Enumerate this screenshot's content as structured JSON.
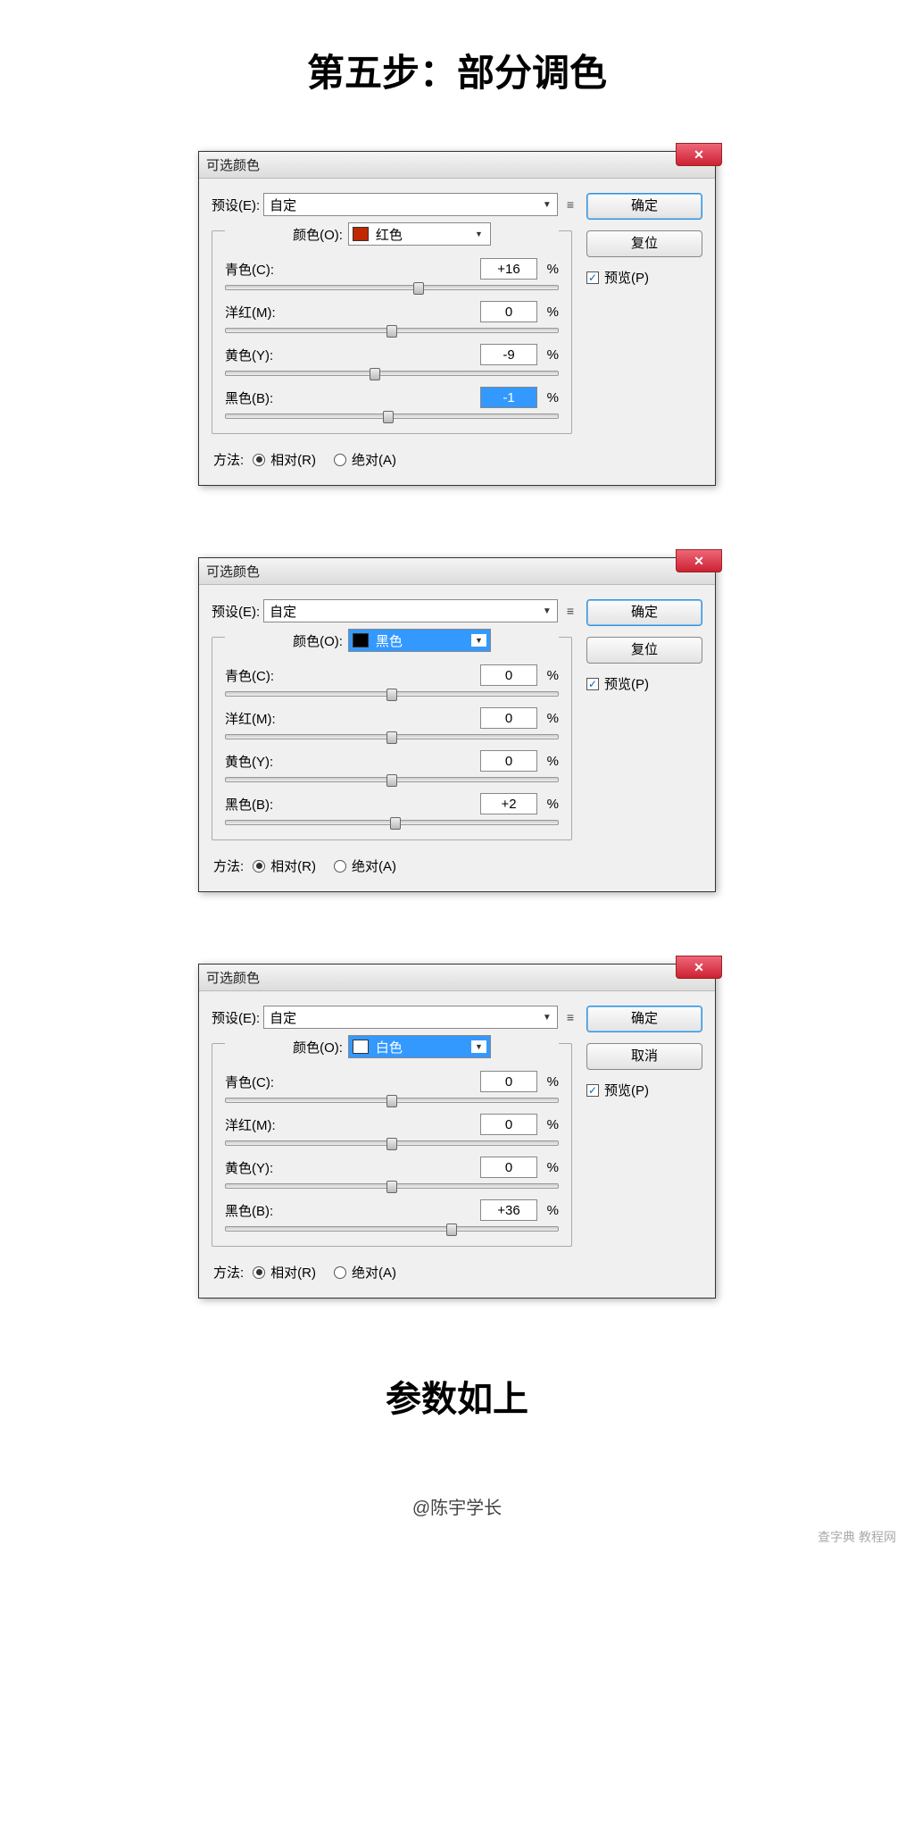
{
  "page_title": "第五步：部分调色",
  "footer_text": "参数如上",
  "credit": "@陈宇学长",
  "watermark": "查字典 教程网",
  "dialogs": [
    {
      "title": "可选颜色",
      "preset_label": "预设(E):",
      "preset_value": "自定",
      "color_label": "颜色(O):",
      "color_swatch": "#c02800",
      "color_name": "红色",
      "color_highlight": false,
      "sliders": [
        {
          "label": "青色(C):",
          "value": "+16",
          "pos": 58,
          "hl": false
        },
        {
          "label": "洋红(M):",
          "value": "0",
          "pos": 50,
          "hl": false
        },
        {
          "label": "黄色(Y):",
          "value": "-9",
          "pos": 45,
          "hl": false
        },
        {
          "label": "黑色(B):",
          "value": "-1",
          "pos": 49,
          "hl": true
        }
      ],
      "method_label": "方法:",
      "method_rel": "相对(R)",
      "method_abs": "绝对(A)",
      "btn_ok": "确定",
      "btn_reset": "复位",
      "preview": "预览(P)"
    },
    {
      "title": "可选颜色",
      "preset_label": "预设(E):",
      "preset_value": "自定",
      "color_label": "颜色(O):",
      "color_swatch": "#000000",
      "color_name": "黑色",
      "color_highlight": true,
      "sliders": [
        {
          "label": "青色(C):",
          "value": "0",
          "pos": 50,
          "hl": false
        },
        {
          "label": "洋红(M):",
          "value": "0",
          "pos": 50,
          "hl": false
        },
        {
          "label": "黄色(Y):",
          "value": "0",
          "pos": 50,
          "hl": false
        },
        {
          "label": "黑色(B):",
          "value": "+2",
          "pos": 51,
          "hl": false
        }
      ],
      "method_label": "方法:",
      "method_rel": "相对(R)",
      "method_abs": "绝对(A)",
      "btn_ok": "确定",
      "btn_reset": "复位",
      "preview": "预览(P)"
    },
    {
      "title": "可选颜色",
      "preset_label": "预设(E):",
      "preset_value": "自定",
      "color_label": "颜色(O):",
      "color_swatch": "#ffffff",
      "color_name": "白色",
      "color_highlight": true,
      "sliders": [
        {
          "label": "青色(C):",
          "value": "0",
          "pos": 50,
          "hl": false
        },
        {
          "label": "洋红(M):",
          "value": "0",
          "pos": 50,
          "hl": false
        },
        {
          "label": "黄色(Y):",
          "value": "0",
          "pos": 50,
          "hl": false
        },
        {
          "label": "黑色(B):",
          "value": "+36",
          "pos": 68,
          "hl": false
        }
      ],
      "method_label": "方法:",
      "method_rel": "相对(R)",
      "method_abs": "绝对(A)",
      "btn_ok": "确定",
      "btn_reset": "取消",
      "preview": "预览(P)"
    }
  ]
}
